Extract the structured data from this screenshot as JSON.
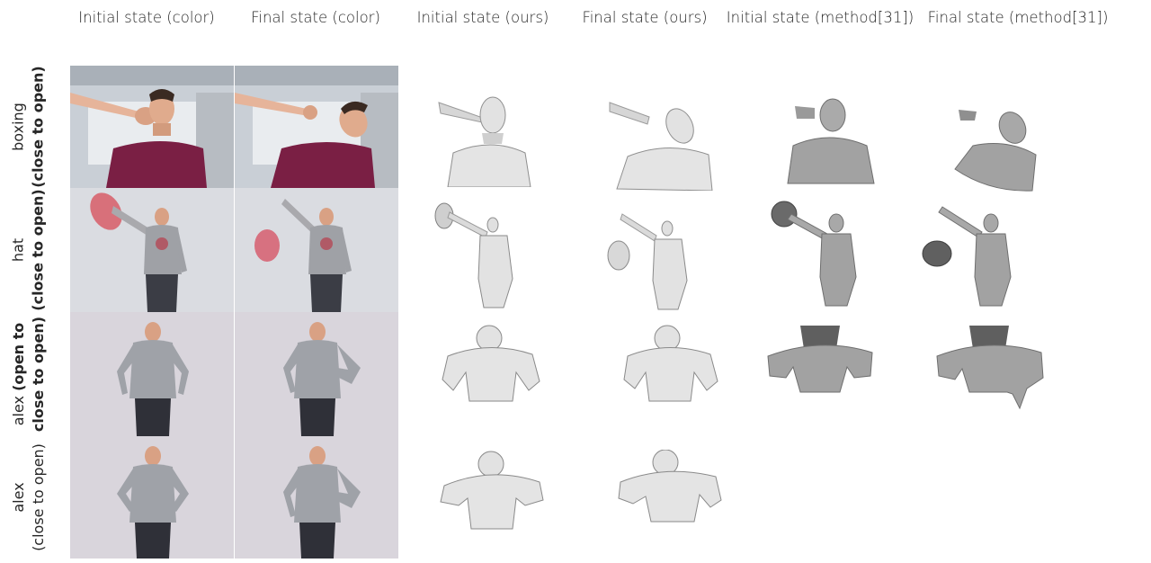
{
  "columns": [
    "Initial state (color)",
    "Final state (color)",
    "Initial state (ours)",
    "Final state (ours)",
    "Initial state (method[31])",
    "Final state (method[31])"
  ],
  "rows": [
    {
      "label_line1": "boxing",
      "label_line2": "(close to open)",
      "line1_bold": false,
      "line2_bold": true
    },
    {
      "label_line1": "hat",
      "label_line2": "(close to open)",
      "line1_bold": false,
      "line2_bold": true
    },
    {
      "label_line1_plain": "alex ",
      "label_line1_bold": "(open to",
      "label_line2": "close to open)",
      "line2_bold": true
    },
    {
      "label_line1": "alex",
      "label_line2": "(close to open)",
      "line1_bold": false,
      "line2_bold": false
    }
  ]
}
